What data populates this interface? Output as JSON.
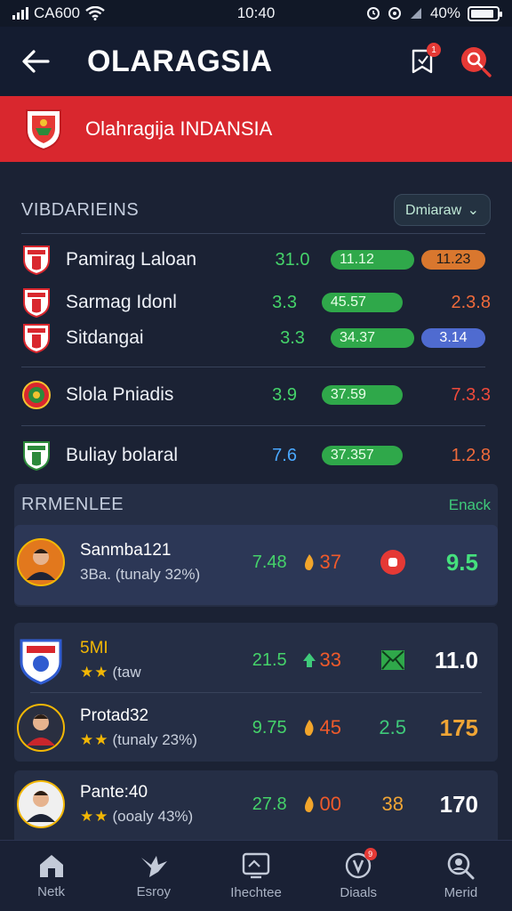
{
  "status_bar": {
    "carrier": "CA600",
    "time": "10:40",
    "battery": "40%",
    "battery_level": 0.9
  },
  "header": {
    "title": "OLARAGSIA",
    "notification_count": "1"
  },
  "league": {
    "name": "Olahragija INDANSIA"
  },
  "standings": {
    "title": "VIBDARIEINS",
    "filter_label": "Dmiaraw",
    "rows": [
      {
        "team": "Pamirag Laloan",
        "a": "31.0",
        "a_color": "#45d36a",
        "b": "11.12",
        "c": "11.23",
        "c_style": "pill",
        "c_color": "#d9772e"
      },
      {
        "team": "Sarmag Idonl",
        "a": "3.3",
        "a_color": "#45d36a",
        "b": "45.57",
        "c": "2.3.8",
        "c_style": "text",
        "c_color": "#ef6a3b"
      },
      {
        "team": "Sitdangai",
        "a": "3.3",
        "a_color": "#45d36a",
        "b": "34.37",
        "c": "3.14",
        "c_style": "pill",
        "c_color": "#4f6bd0"
      },
      {
        "team": "Slola Pniadis",
        "a": "3.9",
        "a_color": "#45d36a",
        "b": "37.59",
        "c": "7.3.3",
        "c_style": "text",
        "c_color": "#ef4a3b"
      },
      {
        "team": "Buliay bolaral",
        "a": "7.6",
        "a_color": "#4aa8ff",
        "b": "37.357",
        "c": "1.2.8",
        "c_style": "text",
        "c_color": "#ef6a3b"
      }
    ]
  },
  "players": {
    "title": "RRMENLEE",
    "link_label": "Enack",
    "rows": [
      {
        "name": "Sanmba121",
        "sub": "3Ba. (tunaly 32%)",
        "stars": "",
        "s1": "7.48",
        "s2": "37",
        "s2_color": "#ef5a2b",
        "s2_icon": "fire",
        "s3_icon": "record",
        "s4": "9.5",
        "s4_color": "#45e07d"
      },
      {
        "name": "5MI",
        "sub": "(taw",
        "stars": "★★",
        "s1": "21.5",
        "s2": "33",
        "s2_color": "#ef5a2b",
        "s2_icon": "up",
        "s3_icon": "mail",
        "s4": "11.0",
        "s4_color": "#ffffff"
      },
      {
        "name": "Protad32",
        "sub": "(tunaly 23%)",
        "stars": "★★",
        "s1": "9.75",
        "s2": "45",
        "s2_color": "#ef5a2b",
        "s2_icon": "fire",
        "s3_text": "2.5",
        "s4": "175",
        "s4_color": "#f0a535"
      },
      {
        "name": "Pante:40",
        "sub": "(ooaly 43%)",
        "stars": "★★",
        "s1": "27.8",
        "s2": "00",
        "s2_color": "#ef5a2b",
        "s2_icon": "fire",
        "s3_text": "38",
        "s4": "170",
        "s4_color": "#ffffff"
      }
    ]
  },
  "bottom_nav": {
    "items": [
      {
        "label": "Netk",
        "icon": "home-icon"
      },
      {
        "label": "Esroy",
        "icon": "bird-icon"
      },
      {
        "label": "Ihechtee",
        "icon": "tablet-icon"
      },
      {
        "label": "Diaals",
        "icon": "shield-icon",
        "badge": "9"
      },
      {
        "label": "Merid",
        "icon": "search-icon"
      }
    ]
  }
}
